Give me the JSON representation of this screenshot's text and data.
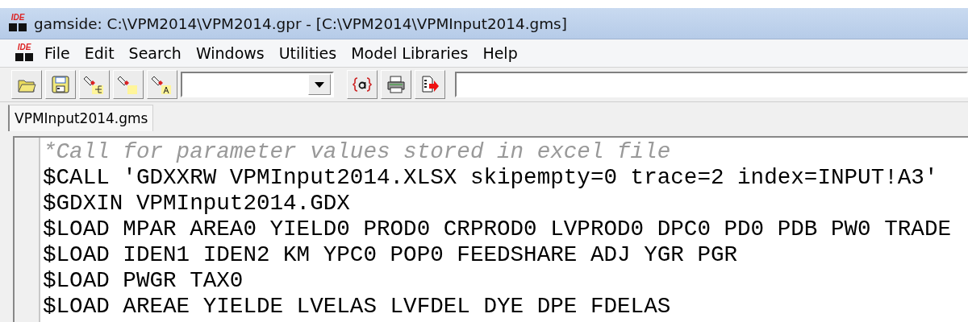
{
  "window": {
    "logo": "IDE",
    "title": "gamside: C:\\VPM2014\\VPM2014.gpr - [C:\\VPM2014\\VPMInput2014.gms]"
  },
  "menu_logo": "IDE",
  "menu": [
    "File",
    "Edit",
    "Search",
    "Windows",
    "Utilities",
    "Model Libraries",
    "Help"
  ],
  "tabs": [
    {
      "label": "VPMInput2014.gms",
      "selected": true
    }
  ],
  "editor": {
    "lines": [
      {
        "kind": "comment",
        "text": "*Call for parameter values stored in excel file"
      },
      {
        "kind": "code",
        "text": "$CALL 'GDXXRW VPMInput2014.XLSX skipempty=0 trace=2 index=INPUT!A3'"
      },
      {
        "kind": "code",
        "text": "$GDXIN VPMInput2014.GDX"
      },
      {
        "kind": "code",
        "text": "$LOAD MPAR AREA0 YIELD0 PROD0 CRPROD0 LVPROD0 DPC0 PD0 PDB PW0 TRADE"
      },
      {
        "kind": "code",
        "text": "$LOAD IDEN1 IDEN2 KM YPC0 POP0 FEEDSHARE ADJ YGR PGR"
      },
      {
        "kind": "code",
        "text": "$LOAD PWGR TAX0"
      },
      {
        "kind": "code",
        "text": "$LOAD AREAE YIELDE LVELAS LVFDEL DYE DPE FDELAS"
      }
    ]
  }
}
